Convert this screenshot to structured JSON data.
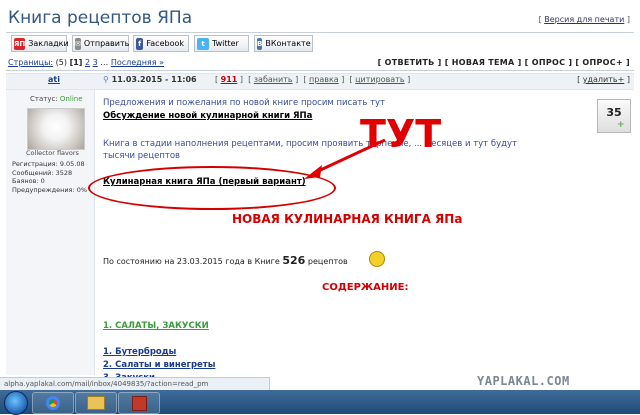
{
  "header": {
    "title": "Книга рецептов ЯПа",
    "print_link": "Версия для печати"
  },
  "share": [
    {
      "label": "Закладки",
      "icon": "yap-icon",
      "color": "#d9252a",
      "icon_text": "ЯП"
    },
    {
      "label": "Отправить",
      "icon": "mail-icon",
      "color": "#8a8a8a",
      "icon_text": "✉"
    },
    {
      "label": "Facebook",
      "icon": "facebook-icon",
      "color": "#3b5998",
      "icon_text": "f"
    },
    {
      "label": "Twitter",
      "icon": "twitter-icon",
      "color": "#4ab3f4",
      "icon_text": "t"
    },
    {
      "label": "ВКонтакте",
      "icon": "vk-icon",
      "color": "#4c75a3",
      "icon_text": "В"
    }
  ],
  "pager": {
    "label": "Страницы:",
    "count": "(5)",
    "current": "[1]",
    "p2": "2",
    "p3": "3",
    "next": "Последняя »"
  },
  "topic_actions": "[ ОТВЕТИТЬ ] [ НОВАЯ ТЕМА ] [ ОПРОС ] [ ОПРОС+ ]",
  "post": {
    "author": "ati",
    "datetime": "11.03.2015 - 11:06",
    "number": "911",
    "actions_pre": "[",
    "actions_a": "забанить",
    "actions_b": "правка",
    "actions_c": "цитировать",
    "delete": "удалить+",
    "score": "35"
  },
  "user": {
    "status_label": "Статус:",
    "status_value": "Online",
    "avatar_caption": "Collector flavors",
    "stats": [
      "Регистрация: 9.05.08",
      "Сообщений: 3528",
      "Баянов: 0",
      "Предупреждения: 0%"
    ]
  },
  "body": {
    "line1": "Предложения и пожелания по новой книге просим писать тут",
    "link1": "Обсуждение новой кулинарной книги ЯПа",
    "line2": "Книга в стадии наполнения рецептами, просим проявить терпение, ... месяцев и тут будут",
    "line3": "тысячи рецептов",
    "link2": "Кулинарная книга ЯПа (первый вариант)",
    "annotation": "ТУТ",
    "heading": "НОВАЯ КУЛИНАРНАЯ КНИГА ЯПа",
    "state_pre": "По состоянию на 23.03.2015 года в Книге",
    "state_num": "526",
    "state_post": "рецептов",
    "contents": "СОДЕРЖАНИЕ:",
    "section1": "1. САЛАТЫ, ЗАКУСКИ",
    "items": [
      "1. Бутерброды",
      "2. Салаты и винегреты",
      "3. Закуски"
    ]
  },
  "statusbar": "alpha.yaplakal.com/mail/inbox/4049835/?action=read_pm",
  "watermark": "YAPLAKAL.COM"
}
